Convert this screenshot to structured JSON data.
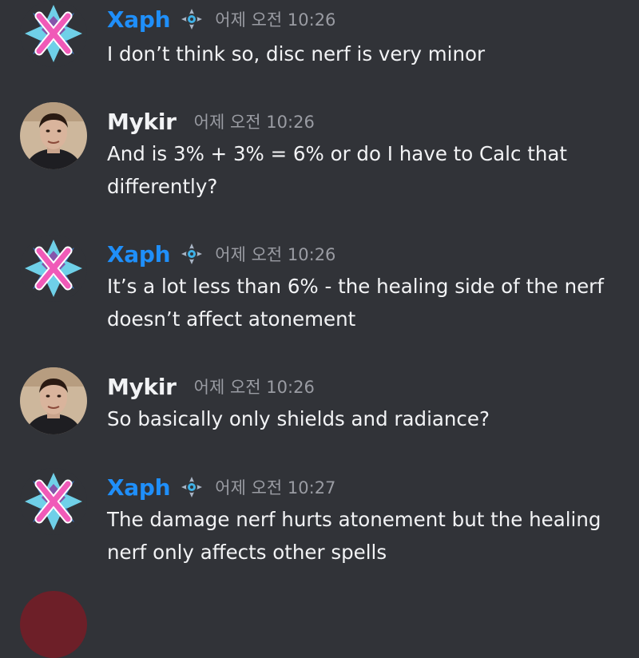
{
  "colors": {
    "background": "#313338",
    "xaph_name": "#1f8ffa",
    "mykir_name": "#f2f3f5",
    "timestamp": "#9a9ca3",
    "message_text": "#f2f3f5"
  },
  "messages": [
    {
      "author": "Xaph",
      "badge_icon": "server-badge-icon",
      "timestamp": "어제 오전 10:26",
      "lines": [
        "I don’t think so, disc nerf is very minor"
      ]
    },
    {
      "author": "Mykir",
      "timestamp": "어제 오전 10:26",
      "lines": [
        "And is 3% + 3% = 6% or do I have to Calc that",
        "differently?"
      ]
    },
    {
      "author": "Xaph",
      "badge_icon": "server-badge-icon",
      "timestamp": "어제 오전 10:26",
      "lines": [
        "It’s a lot less than 6% - the healing side of the nerf",
        "doesn’t affect atonement"
      ]
    },
    {
      "author": "Mykir",
      "timestamp": "어제 오전 10:26",
      "lines": [
        "So basically only shields and radiance?"
      ]
    },
    {
      "author": "Xaph",
      "badge_icon": "server-badge-icon",
      "timestamp": "어제 오전 10:27",
      "lines": [
        "The damage nerf hurts atonement but the healing",
        "nerf only affects other spells"
      ]
    }
  ]
}
